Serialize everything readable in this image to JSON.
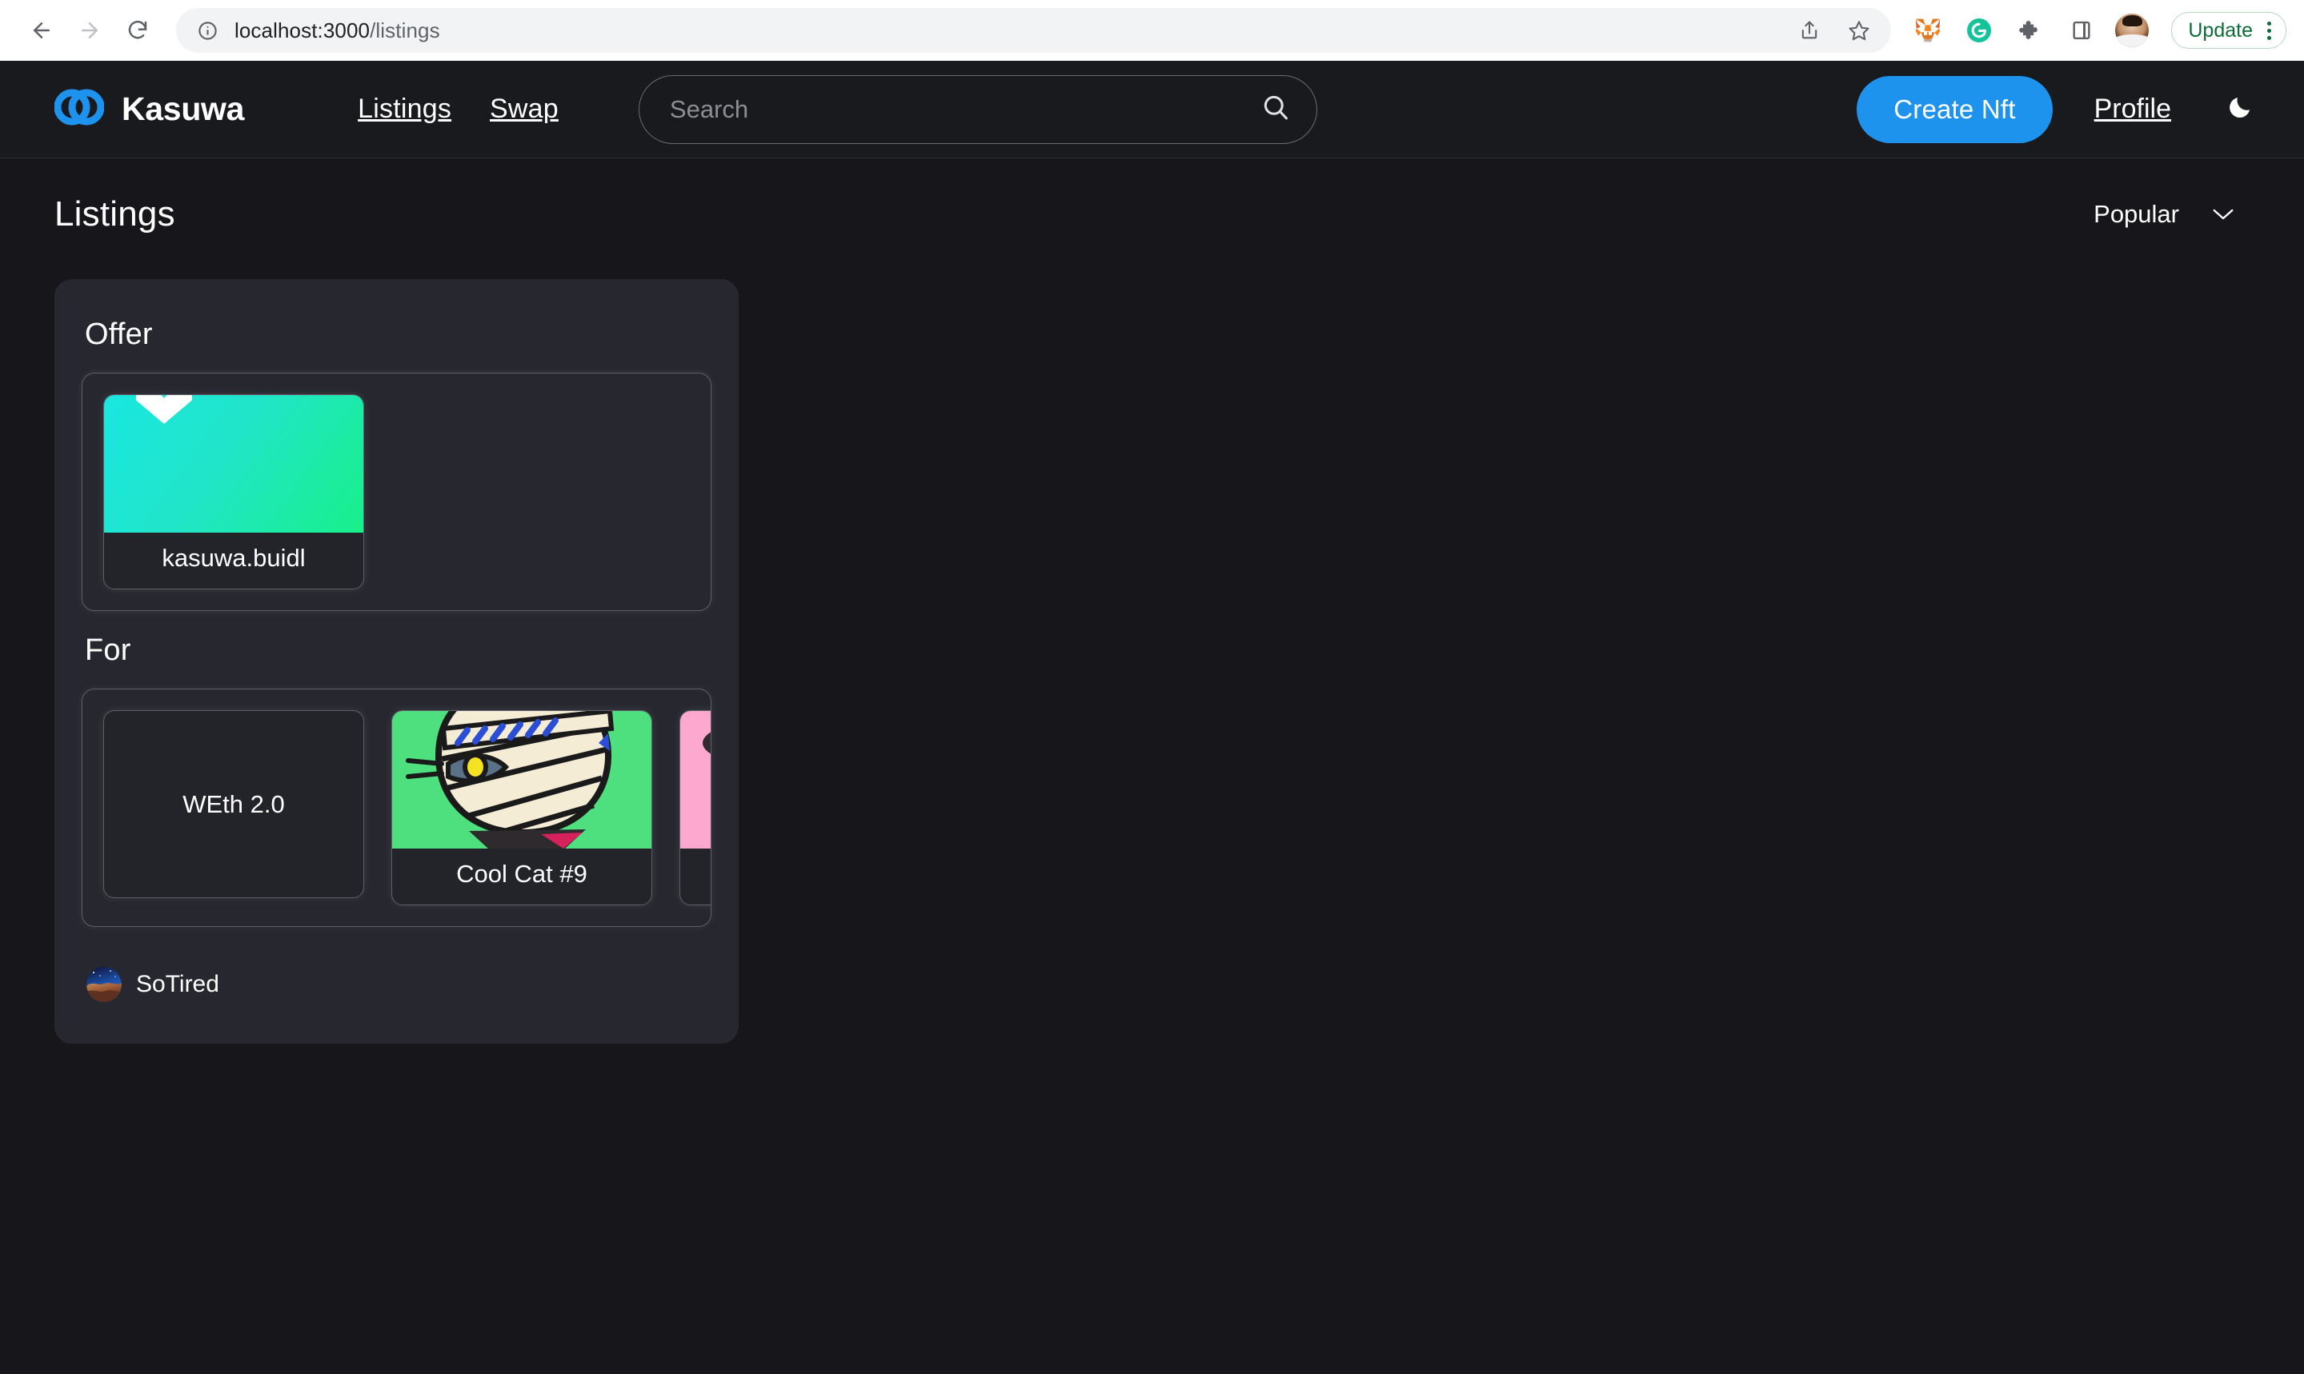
{
  "browser": {
    "url_host": "localhost:3000",
    "url_path": "/listings",
    "back_icon": "back-arrow-icon",
    "forward_icon": "forward-arrow-icon",
    "reload_icon": "reload-icon",
    "info_icon": "site-info-icon",
    "share_icon": "share-icon",
    "bookmark_icon": "star-icon",
    "metamask_icon": "metamask-fox-icon",
    "grammarly_icon": "grammarly-icon",
    "extensions_icon": "puzzle-piece-icon",
    "sidepanel_icon": "side-panel-icon",
    "profile_avatar": "chrome-profile-avatar",
    "update_label": "Update",
    "menu_icon": "kebab-menu-icon"
  },
  "header": {
    "brand": "Kasuwa",
    "logo_icon": "kasuwa-rings-logo",
    "nav": [
      {
        "label": "Listings"
      },
      {
        "label": "Swap"
      }
    ],
    "search": {
      "placeholder": "Search",
      "value": "",
      "icon": "search-icon"
    },
    "create_button": "Create Nft",
    "profile_link": "Profile",
    "theme_toggle_icon": "moon-icon",
    "accent_color": "#1e93ee"
  },
  "page": {
    "title": "Listings",
    "sort": {
      "value": "Popular",
      "chevron_icon": "chevron-down-icon"
    }
  },
  "listings": [
    {
      "offer_label": "Offer",
      "offer_items": [
        {
          "name": "kasuwa.buidl",
          "art": "ens-gradient",
          "art_icon": "ens-hexagon-icon"
        }
      ],
      "for_label": "For",
      "for_items": [
        {
          "name": "WEth 2.0",
          "art": "none"
        },
        {
          "name": "Cool Cat #9",
          "art": "cool-cat-mummy-green"
        },
        {
          "name": "",
          "art": "cool-cat-pink"
        }
      ],
      "seller": {
        "name": "SoTired",
        "avatar_icon": "nebula-avatar"
      }
    }
  ]
}
